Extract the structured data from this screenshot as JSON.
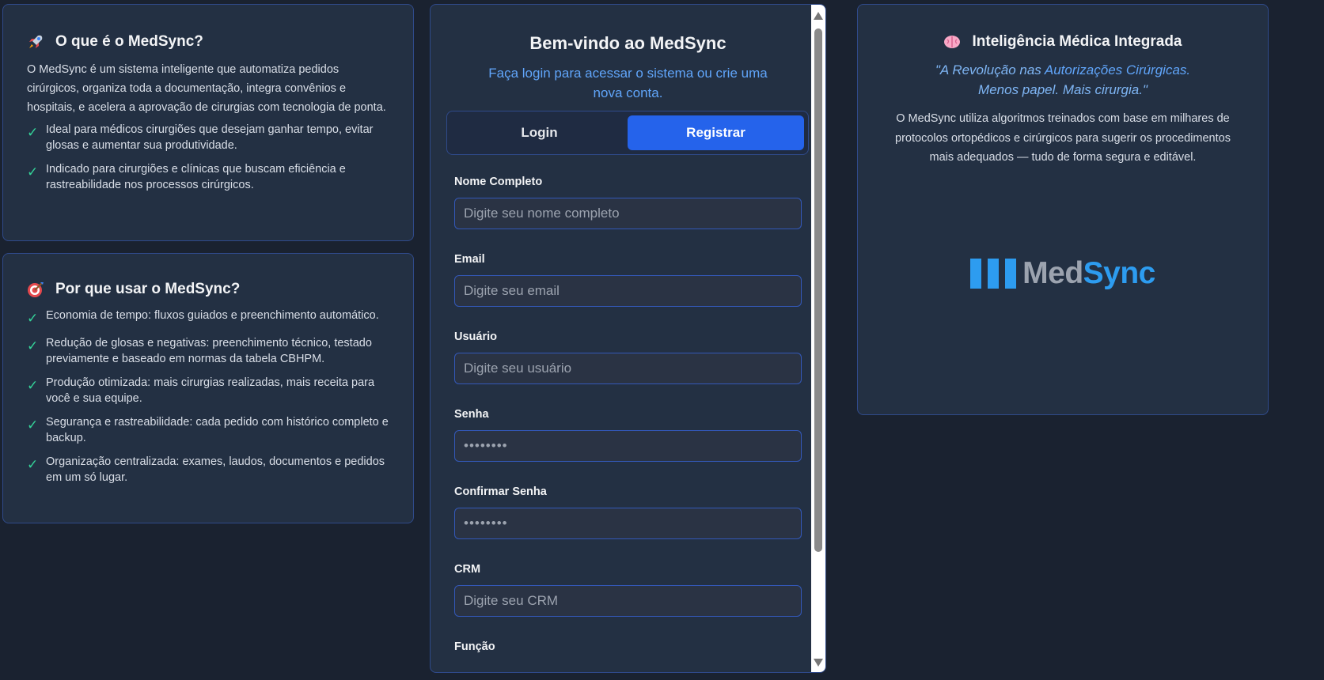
{
  "what_card": {
    "title": "O que é o MedSync?",
    "icon": "rocket-icon",
    "description": "O MedSync é um sistema inteligente que automatiza pedidos cirúrgicos, organiza toda a documentação, integra convênios e hospitais, e acelera a aprovação de cirurgias com tecnologia de ponta.",
    "items": [
      "Ideal para médicos cirurgiões que desejam ganhar tempo, evitar glosas e aumentar sua produtividade.",
      "Indicado para cirurgiões e clínicas que buscam eficiência e rastreabilidade nos processos cirúrgicos."
    ]
  },
  "why_card": {
    "title": "Por que usar o MedSync?",
    "icon": "target-icon",
    "items": [
      "Economia de tempo: fluxos guiados e preenchimento automático.",
      "Redução de glosas e negativas: preenchimento técnico, testado previamente e baseado em normas da tabela CBHPM.",
      "Produção otimizada: mais cirurgias realizadas, mais receita para você e sua equipe.",
      "Segurança e rastreabilidade: cada pedido com histórico completo e backup.",
      "Organização centralizada: exames, laudos, documentos e pedidos em um só lugar."
    ]
  },
  "login_panel": {
    "title": "Bem-vindo ao MedSync",
    "subtitle": "Faça login para acessar o sistema ou crie uma nova conta.",
    "tabs": [
      {
        "label": "Login",
        "active": false
      },
      {
        "label": "Registrar",
        "active": true
      }
    ],
    "fields": [
      {
        "label": "Nome Completo",
        "placeholder": "Digite seu nome completo",
        "value": ""
      },
      {
        "label": "Email",
        "placeholder": "Digite seu email",
        "value": ""
      },
      {
        "label": "Usuário",
        "placeholder": "Digite seu usuário",
        "value": ""
      },
      {
        "label": "Senha",
        "placeholder": "",
        "value": "••••••••"
      },
      {
        "label": "Confirmar Senha",
        "placeholder": "",
        "value": "••••••••"
      },
      {
        "label": "CRM",
        "placeholder": "Digite seu CRM",
        "value": ""
      },
      {
        "label": "Função",
        "placeholder": "",
        "value": ""
      }
    ]
  },
  "ai_card": {
    "title": "Inteligência Médica Integrada",
    "icon": "brain-icon",
    "quote_part1": "\"A Revolução nas ",
    "quote_highlight": "Autorizações Cirúrgicas.",
    "quote_line2": "Menos papel. Mais cirurgia.\"",
    "description": "O MedSync utiliza algoritmos treinados com base em milhares de protocolos ortopédicos e cirúrgicos para sugerir os procedimentos mais adequados — tudo de forma segura e editável.",
    "logo_med": "Med",
    "logo_sync": "Sync"
  },
  "colors": {
    "background": "#1a2230",
    "card": "#233043",
    "border": "#2f4a8a",
    "accent": "#2563eb",
    "check": "#34d399",
    "brand_blue": "#2d9cf0"
  }
}
